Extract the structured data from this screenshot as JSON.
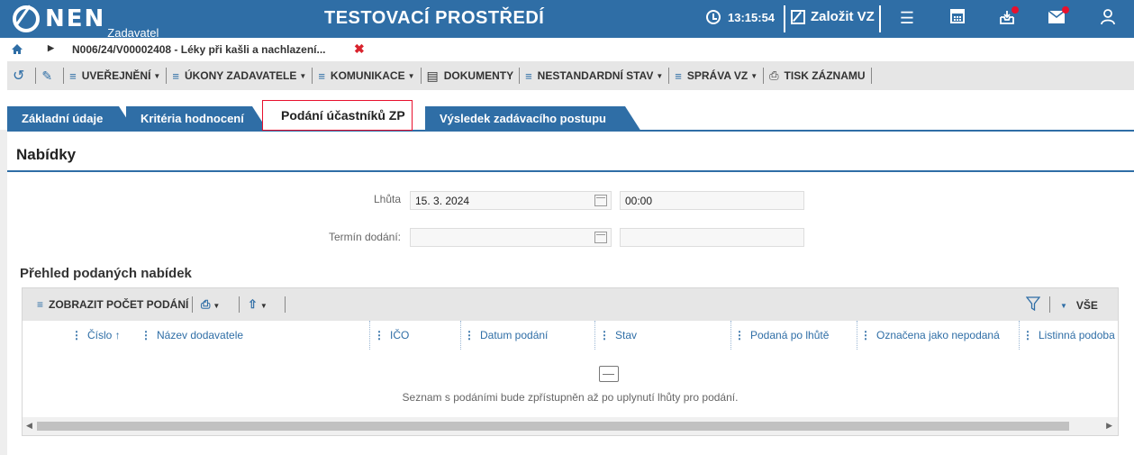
{
  "header": {
    "logo": "NEN",
    "logo_sub": "Zadavatel",
    "environment": "TESTOVACÍ PROSTŘEDÍ",
    "clock": "13:15:54",
    "create_vz": "Založit VZ",
    "icons": [
      "menu-icon",
      "calculator-icon",
      "inbox-icon",
      "mail-icon",
      "user-icon"
    ]
  },
  "breadcrumb": {
    "text": "N006/24/V00002408 - Léky při kašli a nachlazení...",
    "close": "✖"
  },
  "toolbar": {
    "items": [
      {
        "label": "UVEŘEJNĚNÍ",
        "dropdown": true
      },
      {
        "label": "ÚKONY ZADAVATELE",
        "dropdown": true
      },
      {
        "label": "KOMUNIKACE",
        "dropdown": true
      },
      {
        "label": "DOKUMENTY",
        "dropdown": false
      },
      {
        "label": "NESTANDARDNÍ STAV",
        "dropdown": true
      },
      {
        "label": "SPRÁVA VZ",
        "dropdown": true
      },
      {
        "label": "TISK ZÁZNAMU",
        "dropdown": false
      }
    ]
  },
  "tabs": [
    {
      "label": "Základní údaje",
      "active": false
    },
    {
      "label": "Kritéria hodnocení",
      "active": false
    },
    {
      "label": "Podání účastníků ZP",
      "active": true
    },
    {
      "label": "Výsledek zadávacího postupu",
      "active": false
    }
  ],
  "section": {
    "title": "Nabídky"
  },
  "form": {
    "deadline_label": "Lhůta",
    "deadline_date": "15. 3. 2024",
    "deadline_time": "00:00",
    "delivery_label": "Termín dodání:",
    "delivery_date": "",
    "delivery_time": ""
  },
  "grid": {
    "title": "Přehled podaných nabídek",
    "show_count_label": "ZOBRAZIT POČET PODÁNÍ",
    "filter_label": "VŠE",
    "columns": [
      "Číslo ↑",
      "Název dodavatele",
      "IČO",
      "Datum podání",
      "Stav",
      "Podaná po lhůtě",
      "Označena jako nepodaná",
      "Listinná podoba"
    ],
    "empty_message": "Seznam s podáními bude zpřístupněn až po uplynutí lhůty pro podání."
  },
  "colors": {
    "brand_blue": "#2f6ea6",
    "alert_red": "#e8112d"
  }
}
